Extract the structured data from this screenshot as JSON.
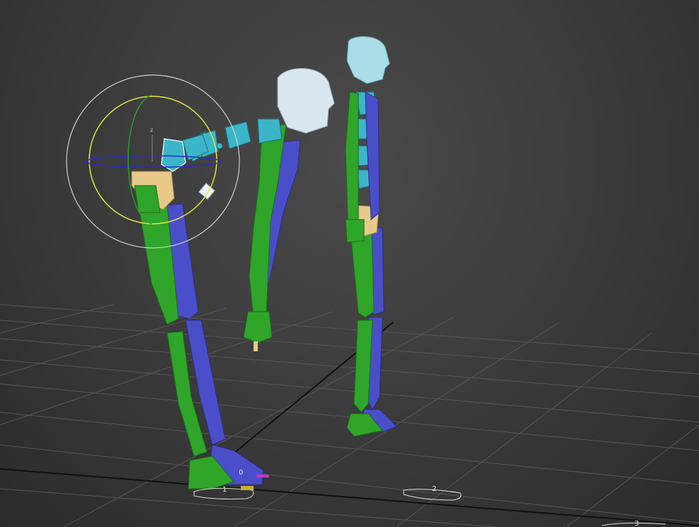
{
  "viewport": {
    "gizmo_axis_label": "z",
    "footstep_labels": [
      "0",
      "1",
      "2",
      "3"
    ]
  },
  "colors": {
    "background": "#3d3d3d",
    "grid": "#5a5a5a",
    "left_limb": "#2fa52a",
    "right_limb": "#4a4ec8",
    "spine": "#3bb6c9",
    "pelvis": "#e8c98a",
    "head": "#d8e6f0",
    "gizmo_ring": "#d8d83a"
  }
}
